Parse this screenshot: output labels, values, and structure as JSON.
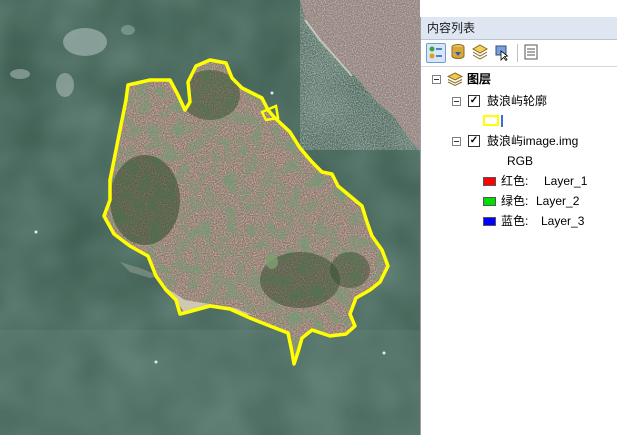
{
  "toc": {
    "title": "内容列表",
    "toolbar": [
      {
        "icon": "list-by-drawing-order-icon",
        "active": true
      },
      {
        "icon": "list-by-source-icon",
        "active": false
      },
      {
        "icon": "list-by-visibility-icon",
        "active": false
      },
      {
        "icon": "list-by-selection-icon",
        "active": false
      },
      {
        "icon": "options-icon",
        "active": false
      }
    ],
    "group": {
      "label": "图层",
      "expanded": true
    },
    "layers": [
      {
        "name": "鼓浪屿轮廓",
        "checked": true,
        "symbol_color": "#ffff00"
      },
      {
        "name": "鼓浪屿image.img",
        "checked": true,
        "rgb_label": "RGB",
        "bands": [
          {
            "color": "#ff0000",
            "label": "红色:",
            "value": "Layer_1"
          },
          {
            "color": "#00dd00",
            "label": "绿色:",
            "value": "Layer_2"
          },
          {
            "color": "#0000ff",
            "label": "蓝色:",
            "value": "Layer_3"
          }
        ]
      }
    ]
  },
  "map": {
    "water_color": "#3a5a4e",
    "outline_color": "#ffff00",
    "shoal_color": "#d9d2b8"
  }
}
